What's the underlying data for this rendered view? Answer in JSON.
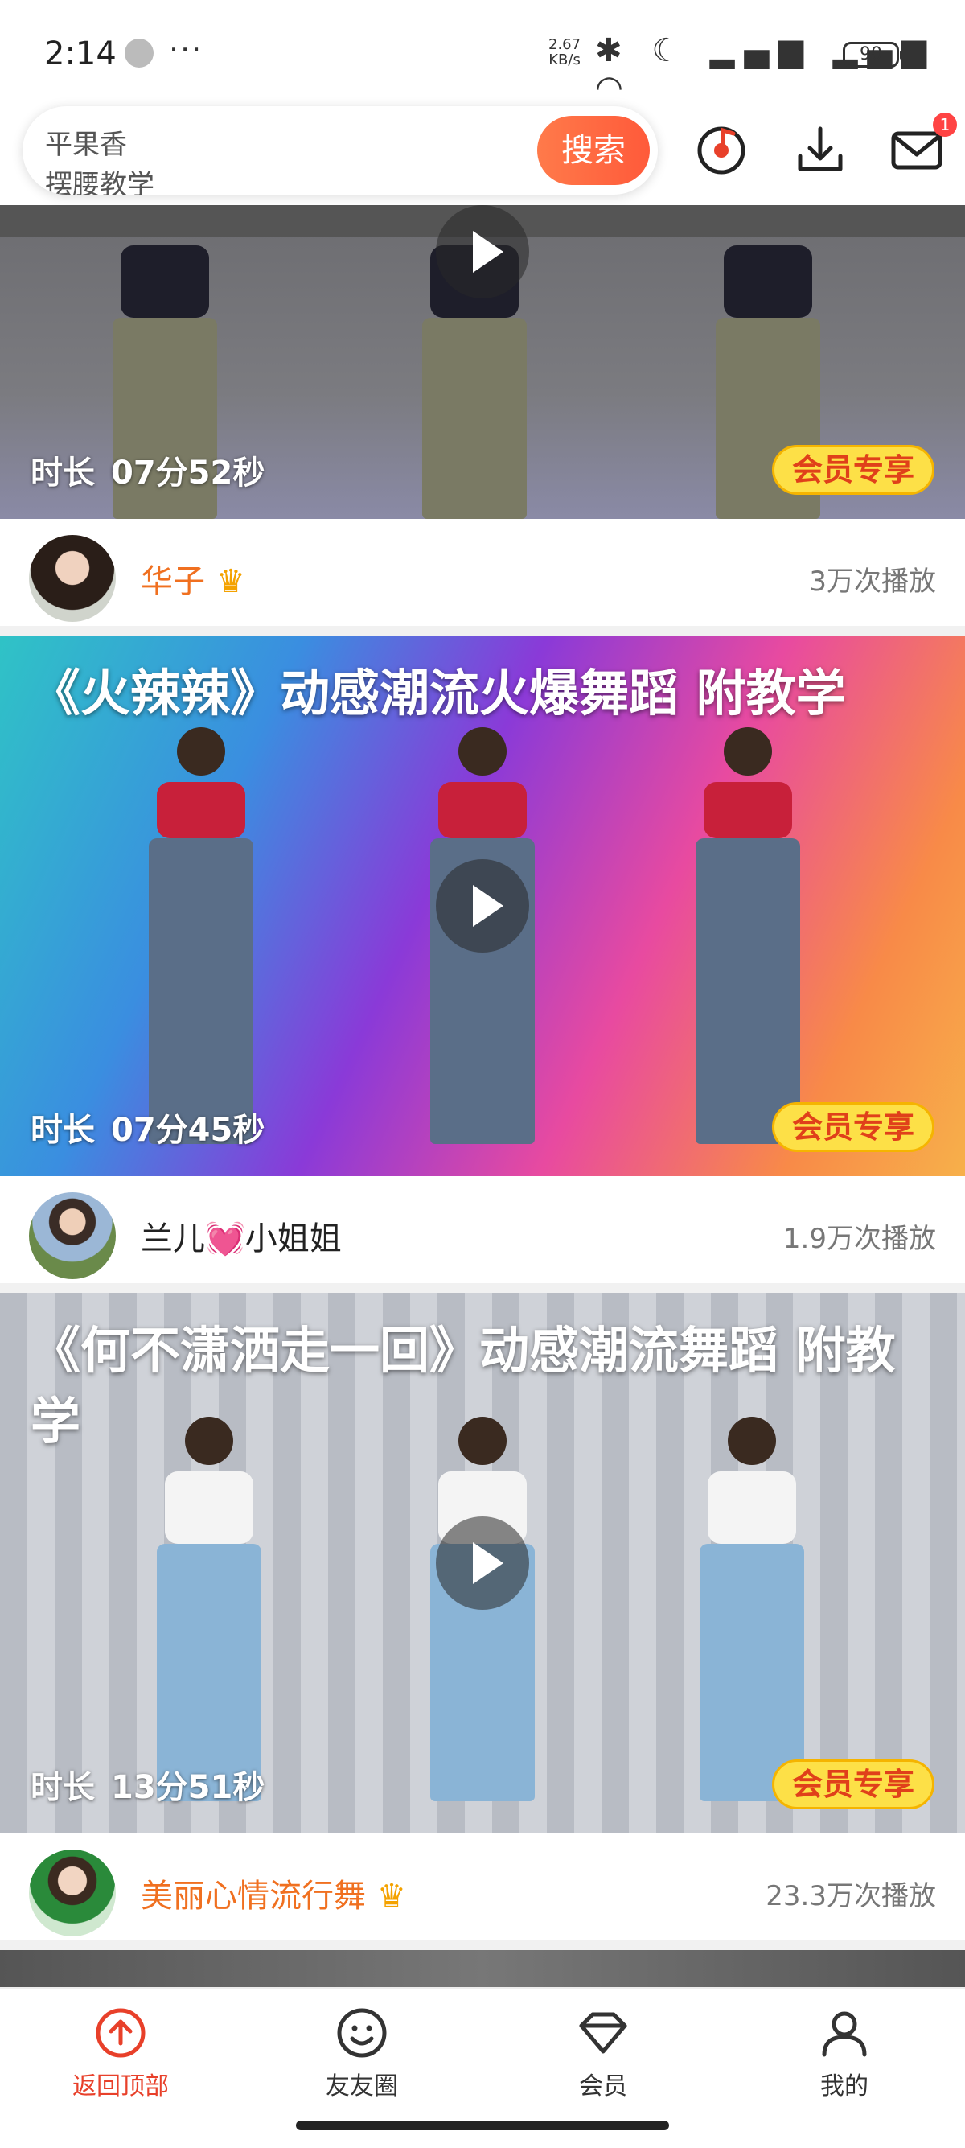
{
  "status_bar": {
    "time": "2:14",
    "net_speed_value": "2.67",
    "net_speed_unit": "KB/s",
    "signal_icons": "✱ ☾ ▂▄▆ ▂▄▆ ◠",
    "battery": "90"
  },
  "search": {
    "placeholder_line1": "平果香",
    "placeholder_line2": "摆腰教学",
    "button_label": "搜索"
  },
  "header_icons": {
    "music_icon": "music-disc-icon",
    "download_icon": "download-icon",
    "mail_icon": "mail-icon",
    "mail_badge": "1"
  },
  "feed": [
    {
      "title": "",
      "duration_label": "时长",
      "duration_value": "07分52秒",
      "vip_label": "会员专享",
      "author": "华子",
      "author_color": "#f07020",
      "plays": "3万次播放"
    },
    {
      "title": "《火辣辣》动感潮流火爆舞蹈 附教学",
      "duration_label": "时长",
      "duration_value": "07分45秒",
      "vip_label": "会员专享",
      "author": "兰儿💓小姐姐",
      "author_color": "#222222",
      "plays": "1.9万次播放"
    },
    {
      "title": "《何不潇洒走一回》动感潮流舞蹈 附教学",
      "duration_label": "时长",
      "duration_value": "13分51秒",
      "vip_label": "会员专享",
      "author": "美丽心情流行舞",
      "author_color": "#f07020",
      "plays": "23.3万次播放"
    }
  ],
  "tab_bar": {
    "items": [
      {
        "label": "返回顶部",
        "icon": "arrow-up-circle-icon",
        "color": "#e8402a"
      },
      {
        "label": "友友圈",
        "icon": "smile-icon",
        "color": "#333333"
      },
      {
        "label": "会员",
        "icon": "diamond-icon",
        "color": "#333333"
      },
      {
        "label": "我的",
        "icon": "person-icon",
        "color": "#333333"
      }
    ]
  }
}
